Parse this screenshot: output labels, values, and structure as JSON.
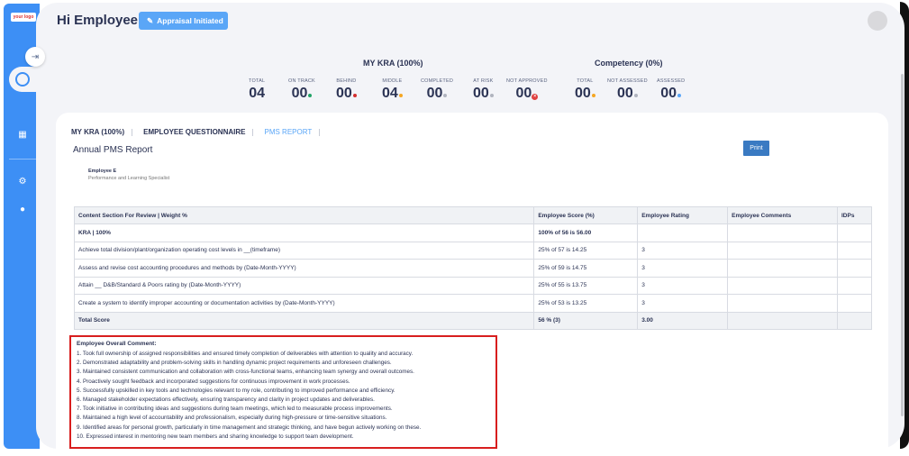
{
  "app": {
    "logo_text": "your logo"
  },
  "header": {
    "greeting": "Hi Employee E",
    "badge": "Appraisal Initiated"
  },
  "colors": {
    "accent": "#3d8ff5",
    "on_track": "#21a366",
    "behind": "#d32f2f",
    "middle": "#f5a623",
    "at_risk": "#b0b4bf",
    "not_approved": "#e04040",
    "highlight_border": "#d81e1e"
  },
  "kra_stats": {
    "title": "MY KRA (100%)",
    "items": [
      {
        "label": "TOTAL",
        "value": "04",
        "dot": ""
      },
      {
        "label": "ON TRACK",
        "value": "00",
        "dot": "#21a366"
      },
      {
        "label": "BEHIND",
        "value": "00",
        "dot": "#d32f2f"
      },
      {
        "label": "MIDDLE",
        "value": "04",
        "dot": "#f5a623"
      },
      {
        "label": "COMPLETED",
        "value": "00",
        "dot": "#b0b4bf"
      },
      {
        "label": "AT RISK",
        "value": "00",
        "dot": "#b0b4bf"
      },
      {
        "label": "NOT APPROVED",
        "value": "00",
        "dot": "x"
      }
    ]
  },
  "competency_stats": {
    "title": "Competency (0%)",
    "items": [
      {
        "label": "TOTAL",
        "value": "00",
        "dot": "#f5a623"
      },
      {
        "label": "NOT ASSESSED",
        "value": "00",
        "dot": "#b0b4bf"
      },
      {
        "label": "ASSESSED",
        "value": "00",
        "dot": "#5aa6f7"
      }
    ]
  },
  "tabs": [
    {
      "label": "MY KRA (100%)"
    },
    {
      "label": "EMPLOYEE QUESTIONNAIRE"
    },
    {
      "label": "PMS REPORT"
    }
  ],
  "report": {
    "title": "Annual PMS Report",
    "print_label": "Print",
    "employee_name": "Employee E",
    "employee_role": "Performance and Learning Specialist"
  },
  "table": {
    "headers": [
      "Content Section For Review | Weight %",
      "Employee Score (%)",
      "Employee Rating",
      "Employee Comments",
      "IDPs"
    ],
    "rows": [
      [
        "KRA | 100%",
        "100% of 56 is 56.00",
        "",
        "",
        ""
      ],
      [
        "Achieve total division/plant/organization operating cost levels in __(timeframe)",
        "25% of 57 is 14.25",
        "3",
        "",
        ""
      ],
      [
        "Assess and revise cost accounting procedures and methods by (Date-Month-YYYY)",
        "25% of 59 is 14.75",
        "3",
        "",
        ""
      ],
      [
        "Attain __ D&B/Standard & Poors rating by (Date-Month-YYYY)",
        "25% of 55 is 13.75",
        "3",
        "",
        ""
      ],
      [
        "Create a system to identify improper accounting or documentation activities by (Date-Month-YYYY)",
        "25% of 53 is 13.25",
        "3",
        "",
        ""
      ],
      [
        "Total Score",
        "56 % (3)",
        "3.00",
        "",
        ""
      ]
    ]
  },
  "overall_comment": {
    "title": "Employee Overall Comment:",
    "lines": [
      "1. Took full ownership of assigned responsibilities and ensured timely completion of deliverables with attention to quality and accuracy.",
      "2. Demonstrated adaptability and problem-solving skills in handling dynamic project requirements and unforeseen challenges.",
      "3. Maintained consistent communication and collaboration with cross-functional teams, enhancing team synergy and overall outcomes.",
      "4. Proactively sought feedback and incorporated suggestions for continuous improvement in work processes.",
      "5. Successfully upskilled in key tools and technologies relevant to my role, contributing to improved performance and efficiency.",
      "6. Managed stakeholder expectations effectively, ensuring transparency and clarity in project updates and deliverables.",
      "7. Took initiative in contributing ideas and suggestions during team meetings, which led to measurable process improvements.",
      "8. Maintained a high level of accountability and professionalism, especially during high-pressure or time-sensitive situations.",
      "9. Identified areas for personal growth, particularly in time management and strategic thinking, and have begun actively working on these.",
      "10. Expressed interest in mentoring new team members and sharing knowledge to support team development."
    ]
  }
}
